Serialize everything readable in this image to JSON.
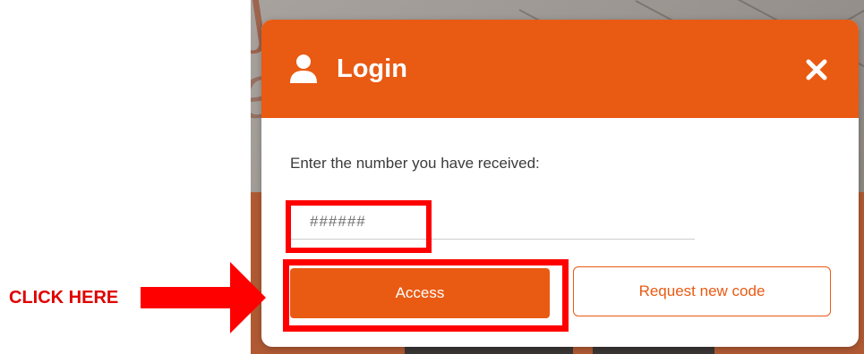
{
  "modal": {
    "title": "Login",
    "prompt": "Enter the number you have received:",
    "code_placeholder": "######",
    "access_label": "Access",
    "request_label": "Request new code"
  },
  "annotation": {
    "label": "CLICK HERE",
    "color": "#ff0000"
  },
  "icons": {
    "user": "user-icon",
    "close": "close-icon",
    "arrow": "arrow-right-icon"
  },
  "colors": {
    "accent": "#e95a13",
    "highlight": "#ff0000",
    "text": "#3b3b3b"
  }
}
